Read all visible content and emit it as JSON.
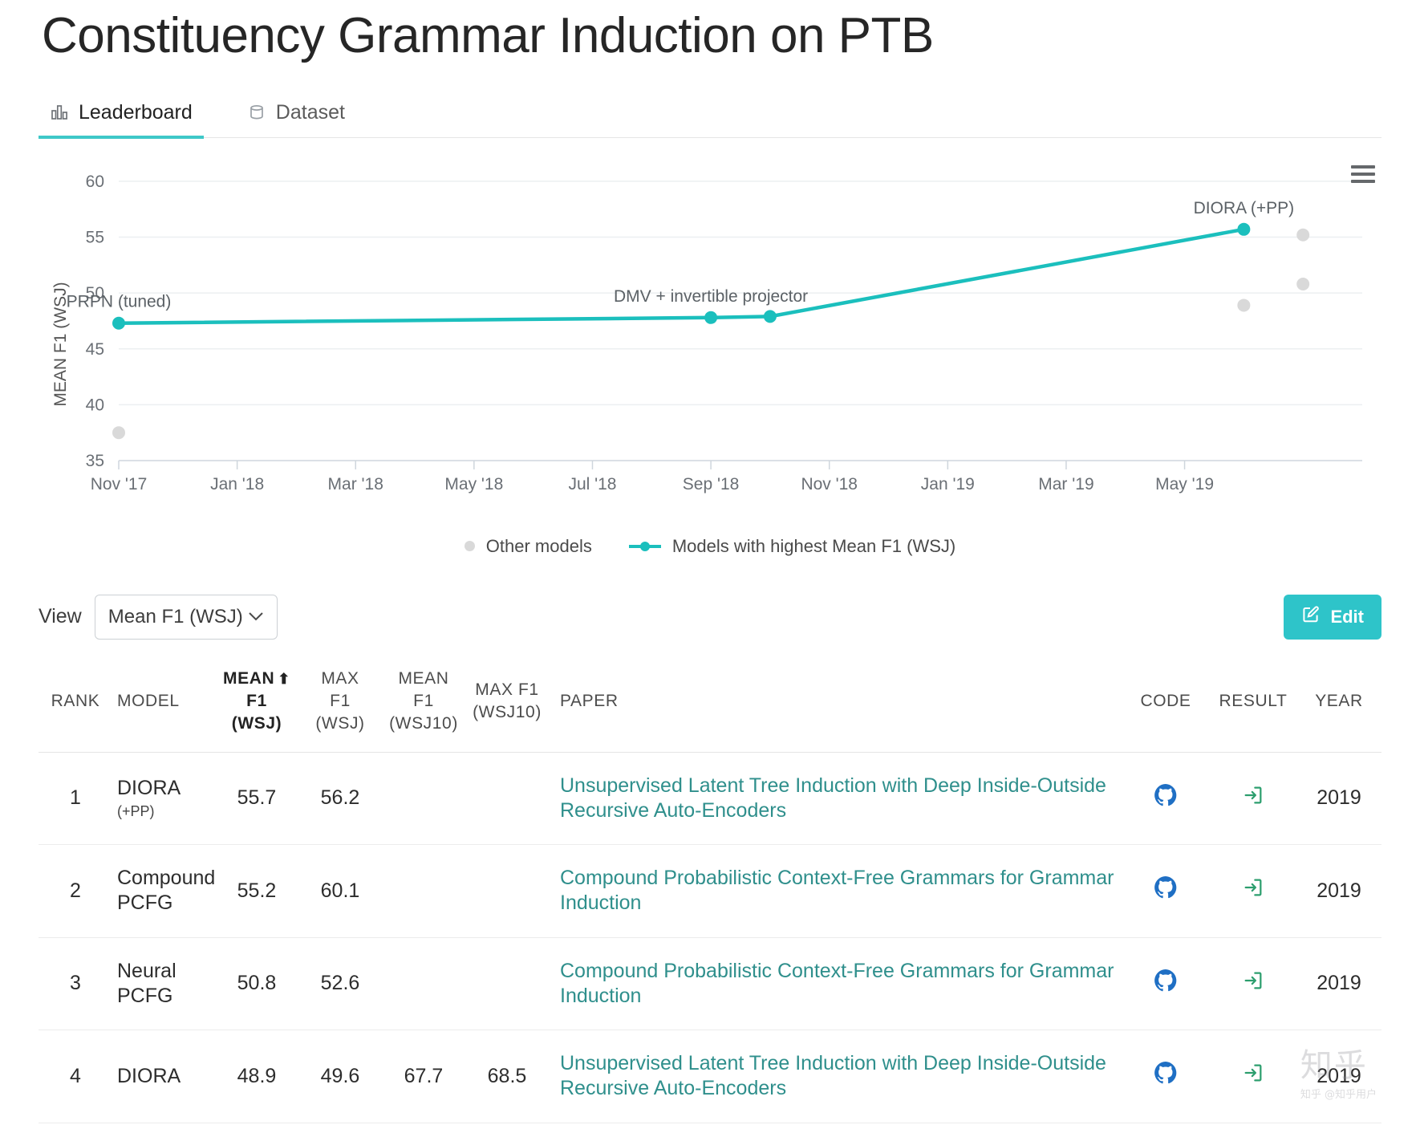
{
  "header": {
    "title": "Constituency Grammar Induction on PTB",
    "tabs": [
      {
        "label": "Leaderboard",
        "icon": "bar-chart-icon",
        "active": true
      },
      {
        "label": "Dataset",
        "icon": "database-icon",
        "active": false
      }
    ]
  },
  "chart_data": {
    "type": "line",
    "title": "",
    "xlabel": "",
    "ylabel": "MEAN F1 (WSJ)",
    "ylim": [
      35,
      61
    ],
    "yticks": [
      35,
      40,
      45,
      50,
      55,
      60
    ],
    "xticks": [
      "Nov '17",
      "Jan '18",
      "Mar '18",
      "May '18",
      "Jul '18",
      "Sep '18",
      "Nov '18",
      "Jan '19",
      "Mar '19",
      "May '19"
    ],
    "grid": true,
    "legend_position": "bottom",
    "accent_color": "#1bbfbd",
    "other_color": "#d9d9d9",
    "series": [
      {
        "name": "Models with highest Mean F1 (WSJ)",
        "color": "#1bbfbd",
        "points": [
          {
            "x": "Nov '17",
            "y": 47.3,
            "label": "PRPN (tuned)"
          },
          {
            "x": "Sep '18",
            "y": 47.8,
            "label": "DMV + invertible projector"
          },
          {
            "x": "Oct '18",
            "y": 47.9,
            "label": ""
          },
          {
            "x": "Jun '19",
            "y": 55.7,
            "label": "DIORA (+PP)"
          }
        ]
      },
      {
        "name": "Other models",
        "color": "#d9d9d9",
        "points": [
          {
            "x": "Nov '17",
            "y": 37.5,
            "label": ""
          },
          {
            "x": "Jun '19",
            "y": 48.9,
            "label": ""
          },
          {
            "x": "Jul '19",
            "y": 55.2,
            "label": ""
          },
          {
            "x": "Jul '19",
            "y": 50.8,
            "label": ""
          }
        ]
      }
    ],
    "legend": [
      {
        "name": "Other models",
        "marker": "dot",
        "color": "#d9d9d9"
      },
      {
        "name": "Models with highest Mean F1 (WSJ)",
        "marker": "line-dot",
        "color": "#1bbfbd"
      }
    ],
    "menu_icon": "hamburger-menu-icon"
  },
  "controls": {
    "view_label": "View",
    "view_value": "Mean F1 (WSJ)",
    "chevron": "chevron-down-icon",
    "edit_label": "Edit",
    "edit_icon": "edit-pencil-icon",
    "edit_color": "#2ec4c9"
  },
  "table": {
    "columns": [
      {
        "key": "rank",
        "label": "RANK",
        "sorted": false
      },
      {
        "key": "model",
        "label": "MODEL",
        "sorted": false
      },
      {
        "key": "mean_f1_wsj",
        "label": "MEAN F1 (WSJ)",
        "sorted": true,
        "sort_dir": "up"
      },
      {
        "key": "max_f1_wsj",
        "label": "MAX F1 (WSJ)",
        "sorted": false
      },
      {
        "key": "mean_f1_wsj10",
        "label": "MEAN F1 (WSJ10)",
        "sorted": false
      },
      {
        "key": "max_f1_wsj10",
        "label": "MAX F1 (WSJ10)",
        "sorted": false
      },
      {
        "key": "paper",
        "label": "PAPER",
        "sorted": false
      },
      {
        "key": "code",
        "label": "CODE",
        "sorted": false
      },
      {
        "key": "result",
        "label": "RESULT",
        "sorted": false
      },
      {
        "key": "year",
        "label": "YEAR",
        "sorted": false
      }
    ],
    "rows": [
      {
        "rank": "1",
        "model": "DIORA",
        "model_sub": "(+PP)",
        "mean_f1_wsj": "55.7",
        "max_f1_wsj": "56.2",
        "mean_f1_wsj10": "",
        "max_f1_wsj10": "",
        "paper": "Unsupervised Latent Tree Induction with Deep Inside-Outside Recursive Auto-Encoders",
        "code": "github-icon",
        "result": "result-arrow-icon",
        "year": "2019"
      },
      {
        "rank": "2",
        "model": "Compound PCFG",
        "model_sub": "",
        "mean_f1_wsj": "55.2",
        "max_f1_wsj": "60.1",
        "mean_f1_wsj10": "",
        "max_f1_wsj10": "",
        "paper": "Compound Probabilistic Context-Free Grammars for Grammar Induction",
        "code": "github-icon",
        "result": "result-arrow-icon",
        "year": "2019"
      },
      {
        "rank": "3",
        "model": "Neural PCFG",
        "model_sub": "",
        "mean_f1_wsj": "50.8",
        "max_f1_wsj": "52.6",
        "mean_f1_wsj10": "",
        "max_f1_wsj10": "",
        "paper": "Compound Probabilistic Context-Free Grammars for Grammar Induction",
        "code": "github-icon",
        "result": "result-arrow-icon",
        "year": "2019"
      },
      {
        "rank": "4",
        "model": "DIORA",
        "model_sub": "",
        "mean_f1_wsj": "48.9",
        "max_f1_wsj": "49.6",
        "mean_f1_wsj10": "67.7",
        "max_f1_wsj10": "68.5",
        "paper": "Unsupervised Latent Tree Induction with Deep Inside-Outside Recursive Auto-Encoders",
        "code": "github-icon",
        "result": "result-arrow-icon",
        "year": "2019"
      }
    ]
  },
  "watermark": {
    "text": "知乎",
    "sub": "知乎 @知乎用户"
  }
}
